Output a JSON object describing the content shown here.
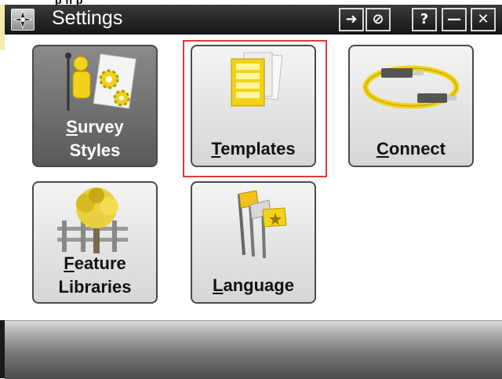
{
  "window": {
    "title": "Settings",
    "app_icon": "compass-rose-icon",
    "top_fragment": "p  n  p"
  },
  "titlebar_buttons": [
    {
      "name": "login-button",
      "icon": "arrow-login-icon",
      "glyph": "➜"
    },
    {
      "name": "cancel-button",
      "icon": "no-entry-icon",
      "glyph": "⊘"
    },
    {
      "name": "help-button",
      "icon": "question-icon",
      "glyph": "?"
    },
    {
      "name": "minimize-button",
      "icon": "minimize-icon",
      "glyph": "—"
    },
    {
      "name": "close-button",
      "icon": "close-icon",
      "glyph": "✕"
    }
  ],
  "tiles": {
    "survey_styles": {
      "line1_ul": "S",
      "line1_rest": "urvey",
      "line2": "Styles",
      "icon": "survey-pole-gears-icon",
      "active": true
    },
    "templates": {
      "ul": "T",
      "rest": "emplates",
      "icon": "template-document-icon",
      "selected": true
    },
    "connect": {
      "ul": "C",
      "rest": "onnect",
      "icon": "usb-cable-icon"
    },
    "feature_libraries": {
      "line1_ul": "F",
      "line1_rest": "eature",
      "line2": "Libraries",
      "icon": "tree-fence-icon"
    },
    "language": {
      "ul": "L",
      "rest": "anguage",
      "icon": "flags-icon"
    }
  },
  "colors": {
    "titlebar": "#1c1c1c",
    "highlight": "#e03a3a",
    "icon_yellow": "#f2d21a"
  }
}
